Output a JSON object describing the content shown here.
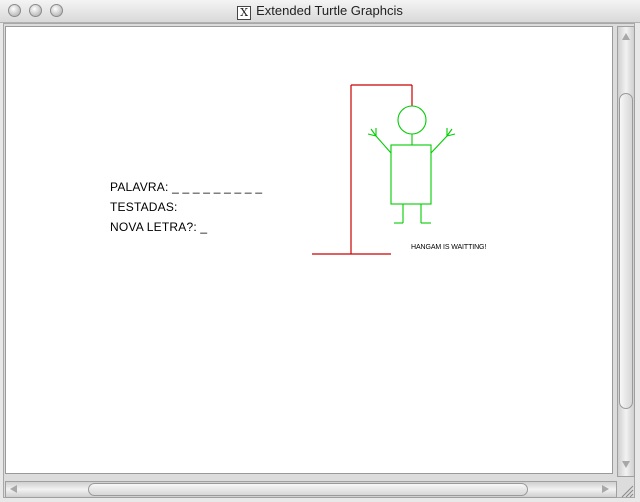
{
  "window": {
    "title": "Extended Turtle Graphcis",
    "app_icon": "x11-icon",
    "app_icon_glyph": "X"
  },
  "game": {
    "word_label": "PALAVRA:",
    "word_value": "_ _ _ _ _ _ _ _ _",
    "tested_label": "TESTADAS:",
    "tested_value": "",
    "prompt_label": "NOVA LETRA?:",
    "prompt_value": "_",
    "status": "HANGAM IS WAITTING!"
  },
  "colors": {
    "gallows": "#cc0000",
    "figure": "#00cc00",
    "text": "#000000",
    "canvas_bg": "#ffffff"
  }
}
